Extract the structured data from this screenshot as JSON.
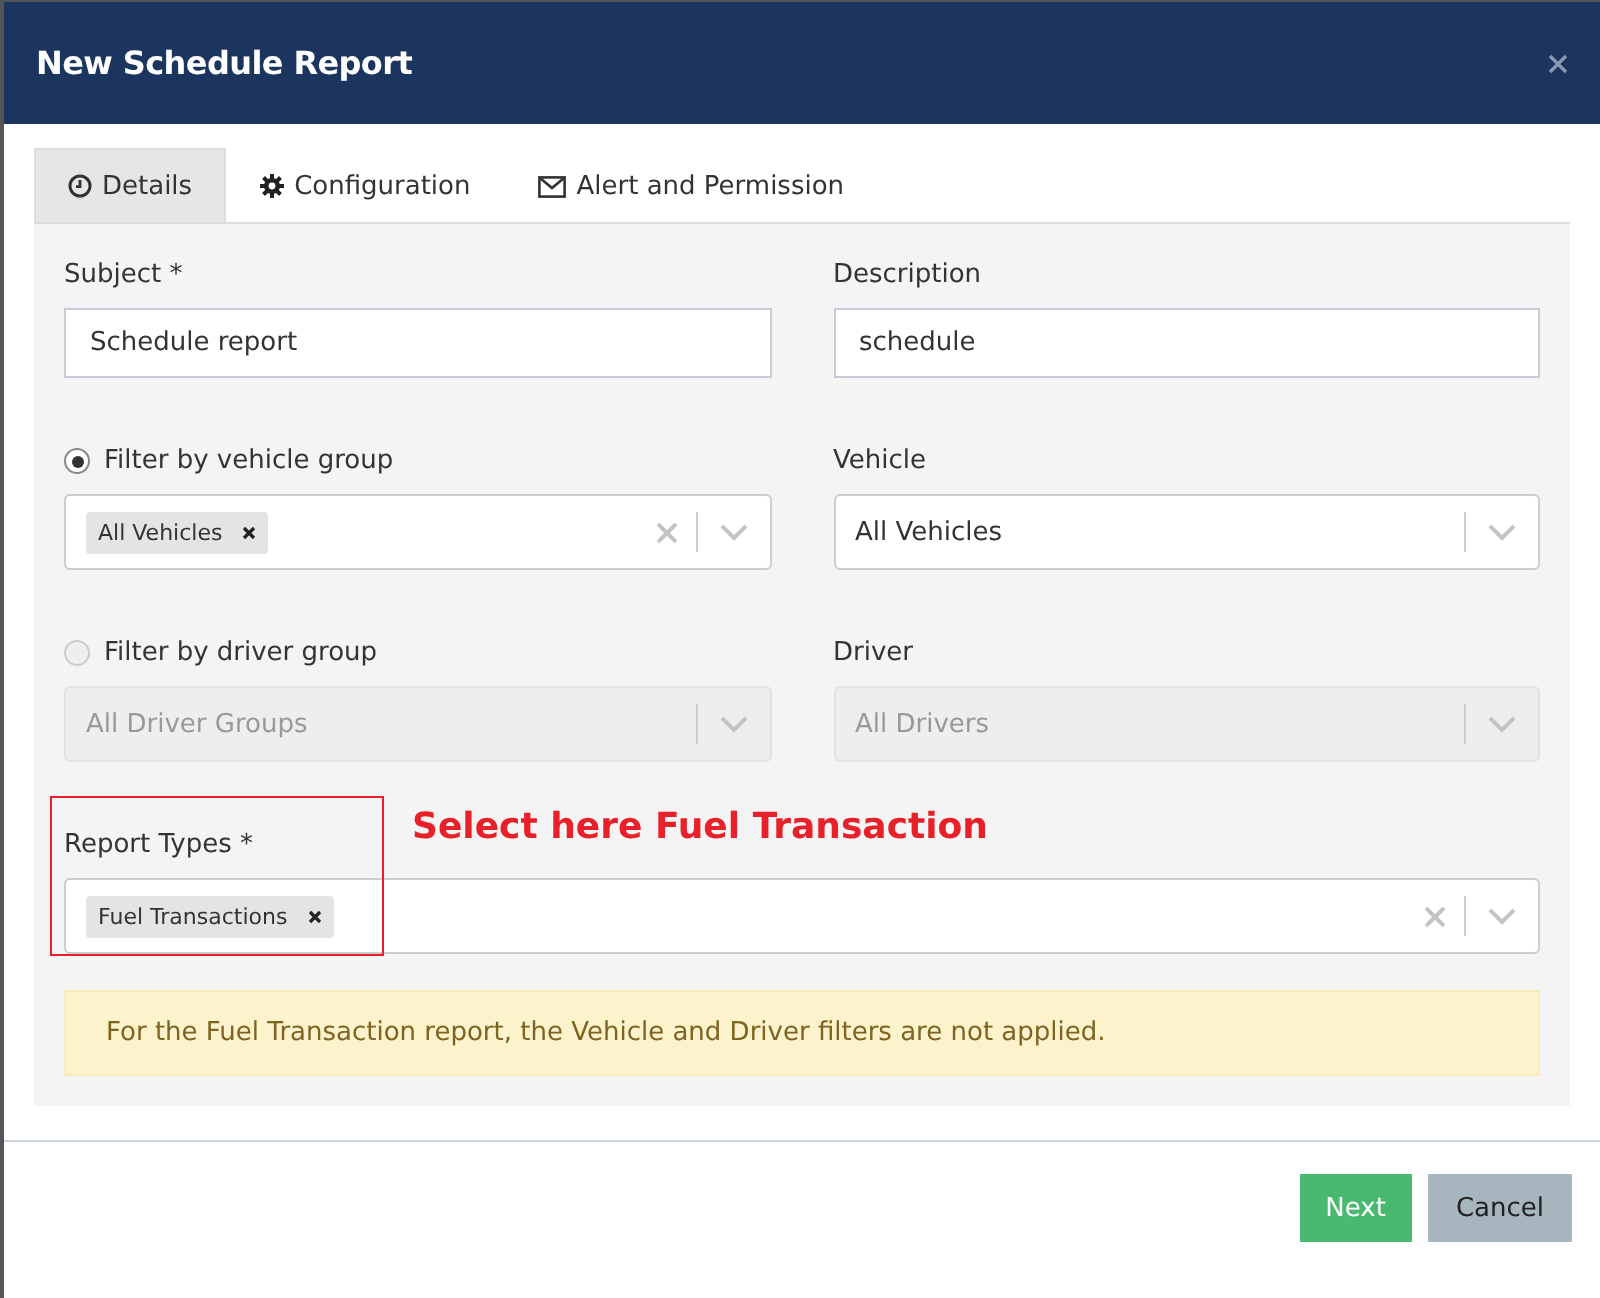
{
  "dialog": {
    "title": "New Schedule Report"
  },
  "tabs": [
    {
      "label": "Details",
      "selected": true
    },
    {
      "label": "Configuration",
      "selected": false
    },
    {
      "label": "Alert and Permission",
      "selected": false
    }
  ],
  "rows": [
    [
      {
        "kind": "text",
        "label": "Subject *",
        "value": "Schedule report"
      },
      {
        "kind": "text",
        "label": "Description",
        "value": "schedule"
      }
    ],
    [
      {
        "kind": "multiselect",
        "radio": {
          "label": "Filter by vehicle group",
          "selected": true
        },
        "chips": [
          "All Vehicles"
        ],
        "disabled": false
      },
      {
        "kind": "select",
        "label": "Vehicle",
        "value": "All Vehicles",
        "disabled": false
      }
    ],
    [
      {
        "kind": "select",
        "radio": {
          "label": "Filter by driver group",
          "selected": false
        },
        "value": "All Driver Groups",
        "disabled": true
      },
      {
        "kind": "select",
        "label": "Driver",
        "value": "All Drivers",
        "disabled": true
      }
    ]
  ],
  "report_types": {
    "label": "Report Types *",
    "chips": [
      "Fuel Transactions"
    ]
  },
  "annotation": {
    "text": "Select here Fuel Transaction"
  },
  "notice": "For the Fuel Transaction report, the Vehicle and Driver filters are not applied.",
  "buttons": [
    {
      "label": "Next",
      "kind": "primary"
    },
    {
      "label": "Cancel",
      "kind": "secondary"
    }
  ]
}
